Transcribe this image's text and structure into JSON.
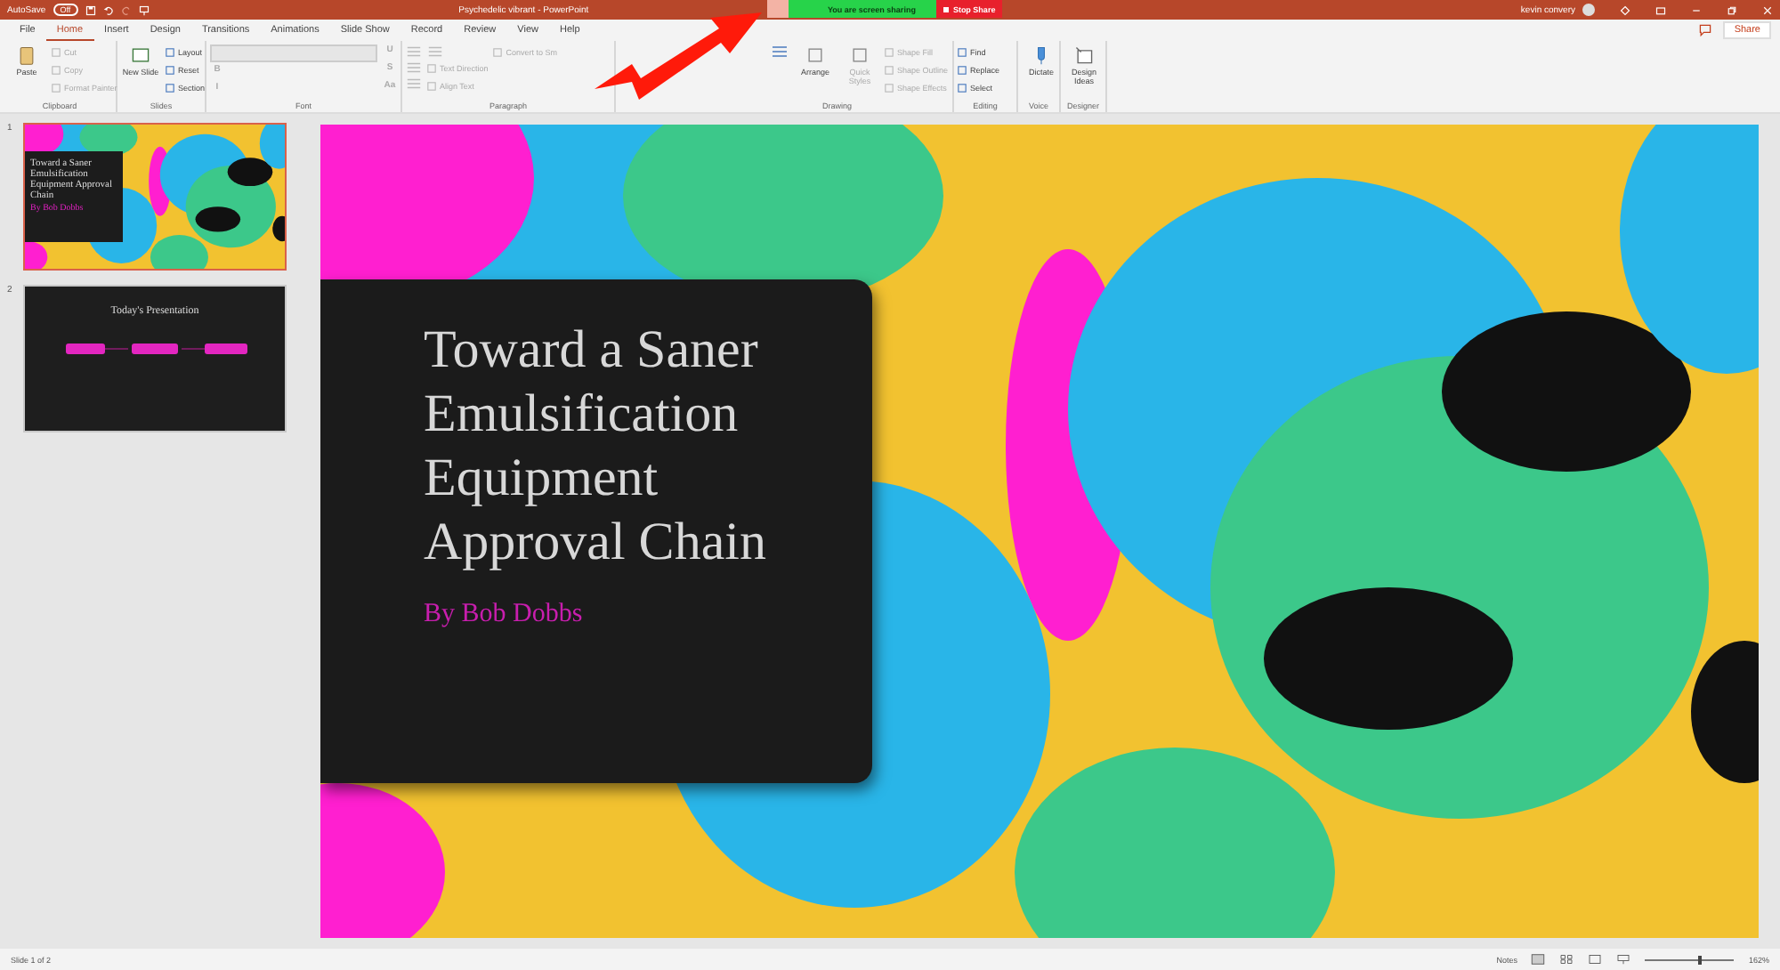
{
  "title_bar": {
    "autosave_label": "AutoSave",
    "autosave_toggle": "Off",
    "autosave_on": false,
    "title": "Psychedelic vibrant  -  PowerPoint",
    "user": "kevin convery"
  },
  "sharing_bar": {
    "status": "You are screen sharing",
    "stop_button": "Stop Share"
  },
  "tabs": [
    {
      "label": "File",
      "selected": false
    },
    {
      "label": "Home",
      "selected": true
    },
    {
      "label": "Insert",
      "selected": false
    },
    {
      "label": "Design",
      "selected": false
    },
    {
      "label": "Transitions",
      "selected": false
    },
    {
      "label": "Animations",
      "selected": false
    },
    {
      "label": "Slide Show",
      "selected": false
    },
    {
      "label": "Record",
      "selected": false
    },
    {
      "label": "Review",
      "selected": false
    },
    {
      "label": "View",
      "selected": false
    },
    {
      "label": "Help",
      "selected": false
    }
  ],
  "share_button": "Share",
  "ribbon": [
    {
      "name": "Clipboard",
      "items": [
        {
          "kind": "large",
          "label": "Paste",
          "disabled": false
        },
        {
          "kind": "small",
          "label": "Cut",
          "disabled": true
        },
        {
          "kind": "small",
          "label": "Copy",
          "disabled": true
        },
        {
          "kind": "small",
          "label": "Format Painter",
          "disabled": true
        }
      ]
    },
    {
      "name": "Slides",
      "items": [
        {
          "kind": "large",
          "label": "New Slide",
          "disabled": false
        },
        {
          "kind": "small",
          "label": "Layout",
          "disabled": false
        },
        {
          "kind": "small",
          "label": "Reset",
          "disabled": false
        },
        {
          "kind": "small",
          "label": "Section",
          "disabled": false
        }
      ]
    },
    {
      "name": "Font",
      "items": [
        {
          "kind": "field",
          "disabled": true
        },
        {
          "kind": "glyph",
          "label": "B",
          "disabled": true
        },
        {
          "kind": "glyph",
          "label": "I",
          "disabled": true
        },
        {
          "kind": "glyph",
          "label": "U",
          "disabled": true
        },
        {
          "kind": "glyph",
          "label": "S",
          "disabled": true
        },
        {
          "kind": "glyph",
          "label": "Aa",
          "disabled": true
        }
      ]
    },
    {
      "name": "Paragraph",
      "items": [
        {
          "kind": "icon",
          "disabled": true
        },
        {
          "kind": "icon",
          "disabled": true
        },
        {
          "kind": "icon",
          "disabled": true
        },
        {
          "kind": "icon",
          "disabled": true
        },
        {
          "kind": "small",
          "label": "Text Direction",
          "disabled": true
        },
        {
          "kind": "small",
          "label": "Align Text",
          "disabled": true
        },
        {
          "kind": "small",
          "label": "Convert to Sm",
          "disabled": true
        }
      ]
    },
    {
      "name": "Drawing",
      "items": [
        {
          "kind": "icon",
          "disabled": false
        },
        {
          "kind": "large",
          "label": "Arrange",
          "disabled": false
        },
        {
          "kind": "large",
          "label": "Quick Styles",
          "disabled": true
        },
        {
          "kind": "small",
          "label": "Shape Fill",
          "disabled": true
        },
        {
          "kind": "small",
          "label": "Shape Outline",
          "disabled": true
        },
        {
          "kind": "small",
          "label": "Shape Effects",
          "disabled": true
        }
      ]
    },
    {
      "name": "Editing",
      "items": [
        {
          "kind": "small",
          "label": "Find",
          "disabled": false
        },
        {
          "kind": "small",
          "label": "Replace",
          "disabled": false
        },
        {
          "kind": "small",
          "label": "Select",
          "disabled": false
        }
      ]
    },
    {
      "name": "Voice",
      "items": [
        {
          "kind": "large",
          "label": "Dictate",
          "disabled": false
        }
      ]
    },
    {
      "name": "Designer",
      "items": [
        {
          "kind": "large",
          "label": "Design Ideas",
          "disabled": false
        }
      ]
    }
  ],
  "slides": [
    {
      "number": "1",
      "kind": "title",
      "selected": true,
      "title": "Toward a Saner Emulsification Equipment Approval Chain",
      "subtitle": "By Bob Dobbs"
    },
    {
      "number": "2",
      "kind": "agenda",
      "selected": false,
      "title": "Today's Presentation"
    }
  ],
  "slide": {
    "title": "Toward a Saner Emulsification Equipment Approval Chain",
    "subtitle": "By Bob Dobbs"
  },
  "status_bar": {
    "slide_count": "Slide 1 of 2",
    "notes": "Notes",
    "zoom": "162%",
    "zoom_slider": {
      "level": 0.62
    }
  }
}
